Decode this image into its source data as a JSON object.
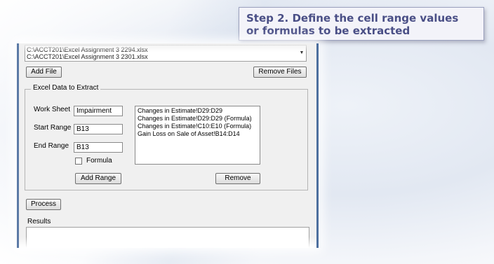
{
  "callout": {
    "line1": "Step 2. Define the cell range values",
    "line2": "or formulas to be extracted"
  },
  "files": {
    "items": [
      "C:\\ACCT201\\Excel Assignment 3 2294.xlsx",
      "C:\\ACCT201\\Excel Assignment 3 2301.xlsx"
    ],
    "add_label": "Add File",
    "remove_label": "Remove Files"
  },
  "extract": {
    "group_title": "Excel Data to Extract",
    "worksheet_label": "Work Sheet",
    "worksheet_value": "Impairment",
    "start_label": "Start Range",
    "start_value": "B13",
    "end_label": "End Range",
    "end_value": "B13",
    "formula_label": "Formula",
    "formula_checked": false,
    "add_range_label": "Add Range",
    "remove_label": "Remove",
    "ranges": [
      "Changes in Estimate!D29:D29",
      "Changes in Estimate!D29:D29 (Formula)",
      "Changes in Estimate!C10:E10 (Formula)",
      "Gain Loss on Sale of Asset!B14:D14"
    ]
  },
  "process_label": "Process",
  "results_label": "Results"
}
